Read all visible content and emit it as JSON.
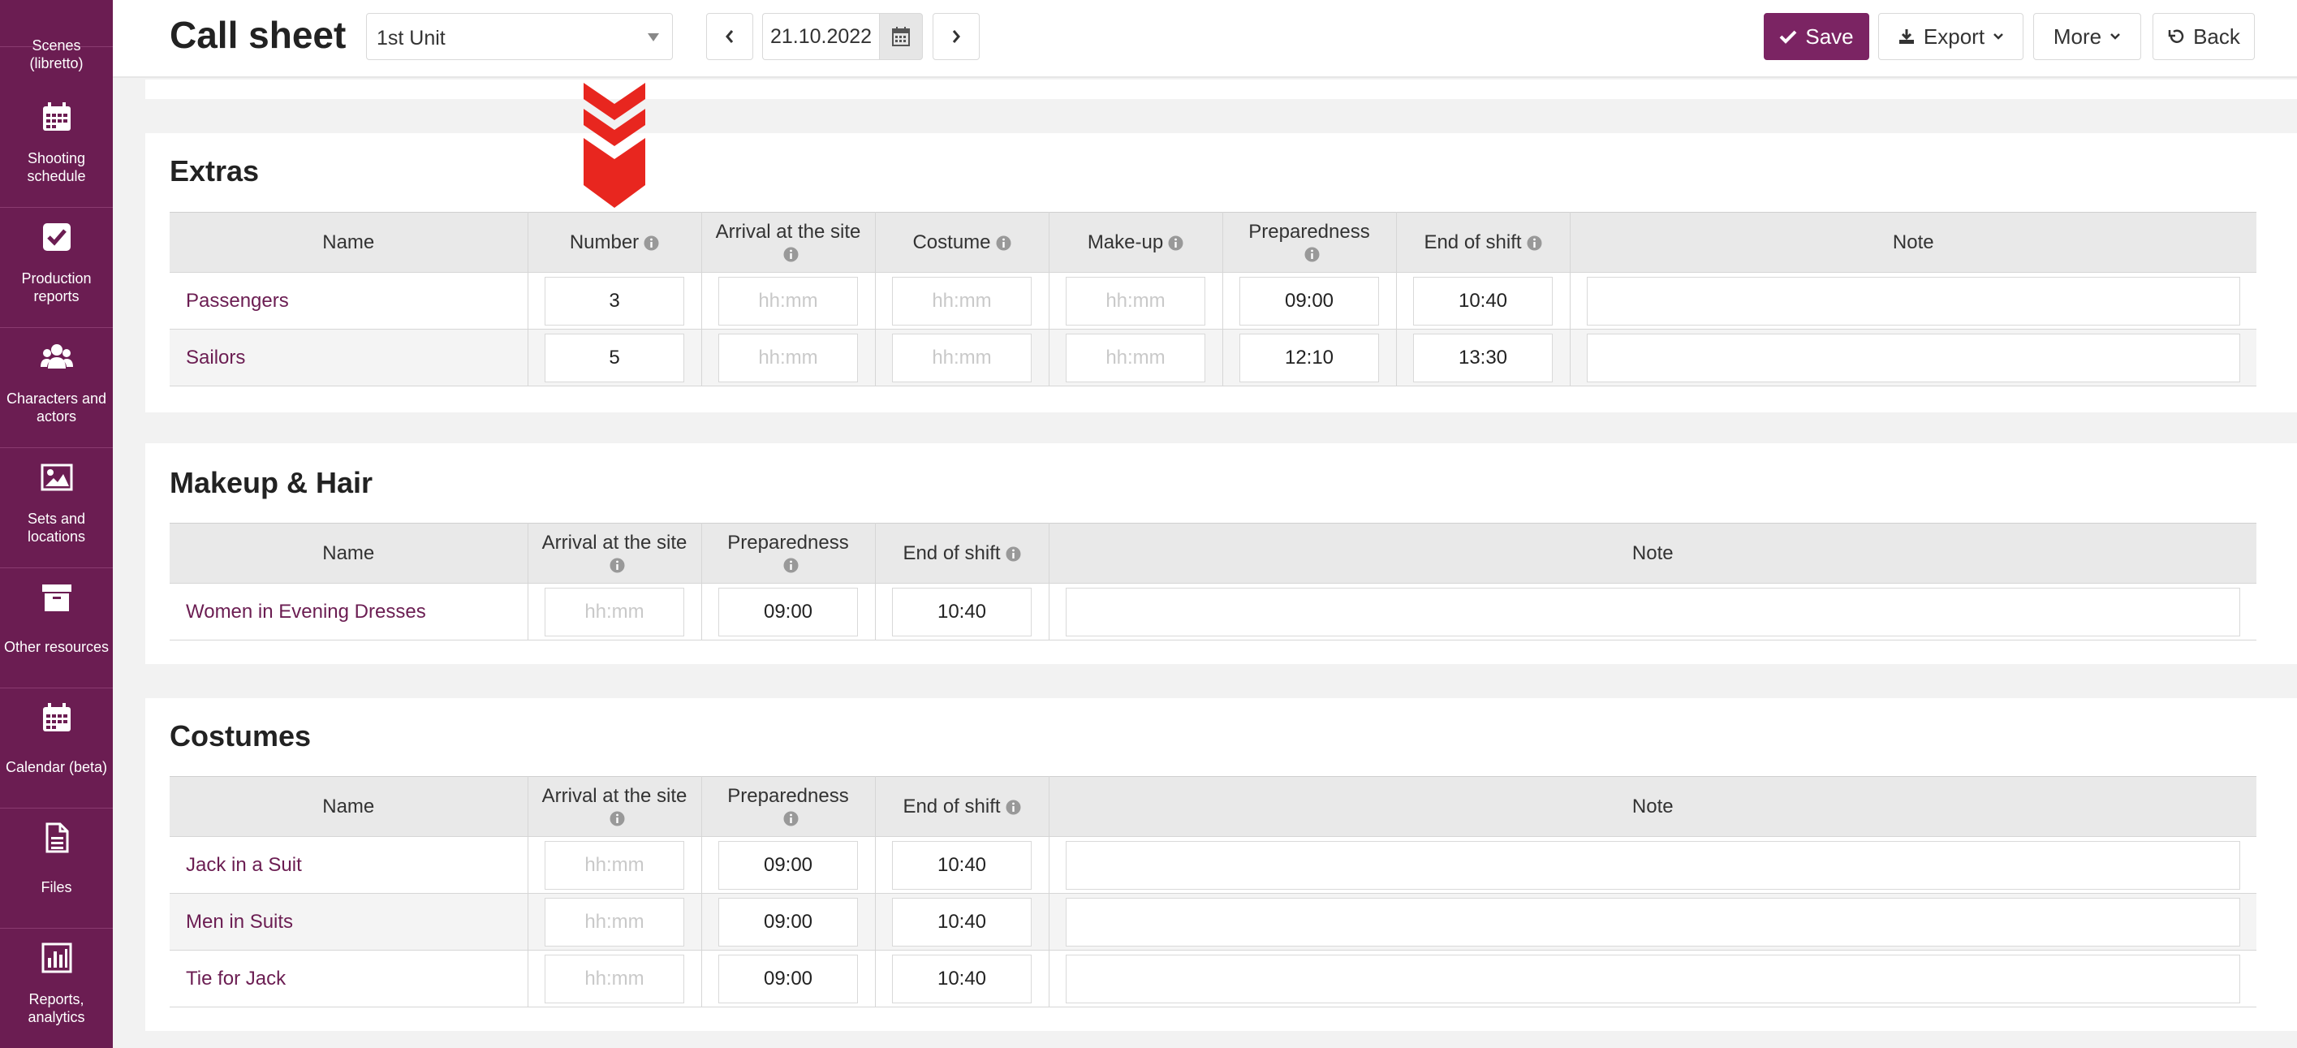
{
  "sidebar": {
    "items": [
      {
        "label": "Scenes (libretto)",
        "icon": "list-icon"
      },
      {
        "label": "Shooting schedule",
        "icon": "calendar-icon"
      },
      {
        "label": "Production reports",
        "icon": "checkbox-icon"
      },
      {
        "label": "Characters and actors",
        "icon": "users-icon"
      },
      {
        "label": "Sets and locations",
        "icon": "image-icon"
      },
      {
        "label": "Other resources",
        "icon": "archive-icon"
      },
      {
        "label": "Calendar (beta)",
        "icon": "calendar-icon"
      },
      {
        "label": "Files",
        "icon": "file-icon"
      },
      {
        "label": "Reports, analytics",
        "icon": "bar-chart-icon"
      }
    ]
  },
  "header": {
    "title": "Call sheet",
    "unit_select": "1st Unit",
    "date": "21.10.2022",
    "save_label": "Save",
    "export_label": "Export",
    "more_label": "More",
    "back_label": "Back"
  },
  "extras": {
    "title": "Extras",
    "columns": {
      "name": "Name",
      "number": "Number",
      "arrival": "Arrival at the site",
      "costume": "Costume",
      "makeup": "Make-up",
      "preparedness": "Preparedness",
      "end_of_shift": "End of shift",
      "note": "Note"
    },
    "placeholder": "hh:mm",
    "rows": [
      {
        "name": "Passengers",
        "number": "3",
        "preparedness": "09:00",
        "end_of_shift": "10:40"
      },
      {
        "name": "Sailors",
        "number": "5",
        "preparedness": "12:10",
        "end_of_shift": "13:30"
      }
    ]
  },
  "makeup_hair": {
    "title": "Makeup & Hair",
    "columns": {
      "name": "Name",
      "arrival": "Arrival at the site",
      "preparedness": "Preparedness",
      "end_of_shift": "End of shift",
      "note": "Note"
    },
    "placeholder": "hh:mm",
    "rows": [
      {
        "name": "Women in Evening Dresses",
        "preparedness": "09:00",
        "end_of_shift": "10:40"
      }
    ]
  },
  "costumes": {
    "title": "Costumes",
    "columns": {
      "name": "Name",
      "arrival": "Arrival at the site",
      "preparedness": "Preparedness",
      "end_of_shift": "End of shift",
      "note": "Note"
    },
    "placeholder": "hh:mm",
    "rows": [
      {
        "name": "Jack in a Suit",
        "preparedness": "09:00",
        "end_of_shift": "10:40"
      },
      {
        "name": "Men in Suits",
        "preparedness": "09:00",
        "end_of_shift": "10:40"
      },
      {
        "name": "Tie for Jack",
        "preparedness": "09:00",
        "end_of_shift": "10:40"
      }
    ]
  },
  "colors": {
    "sidebar": "#6b1d52",
    "accent": "#7b2463",
    "link": "#6b1d52",
    "annotation_arrow": "#e8261f"
  }
}
